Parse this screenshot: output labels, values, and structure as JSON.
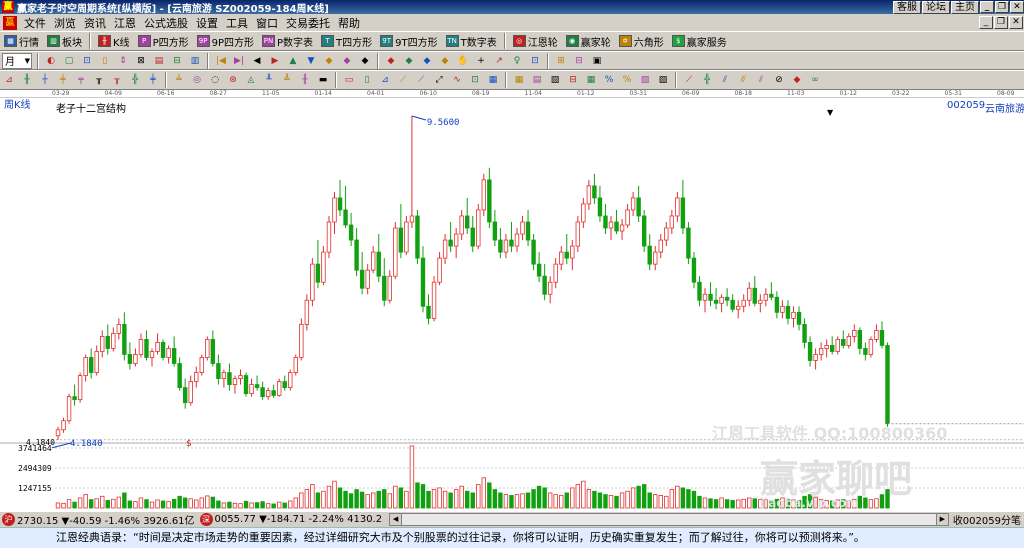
{
  "window": {
    "title": "赢家老子时空周期系统[纵横版] - [云南旅游  SZ002059-184周K线]",
    "links": [
      "客服",
      "论坛",
      "主页"
    ],
    "controls": [
      "_",
      "❐",
      "✕"
    ]
  },
  "menu": [
    "文件",
    "浏览",
    "资讯",
    "江恩",
    "公式选股",
    "设置",
    "工具",
    "窗口",
    "交易委托",
    "帮助"
  ],
  "toolbar1": [
    {
      "icon": "grid-icon",
      "glyph": "▦",
      "color": "#3060a0",
      "label": "行情"
    },
    {
      "icon": "blocks-icon",
      "glyph": "▥",
      "color": "#208040",
      "label": "板块"
    },
    {
      "icon": "kline-icon",
      "glyph": "╫",
      "color": "#c02020",
      "label": "K线"
    },
    {
      "icon": "p-square-icon",
      "glyph": "P",
      "color": "#a040a0",
      "label": "P四方形"
    },
    {
      "icon": "9p-square-icon",
      "glyph": "9P",
      "color": "#a040a0",
      "label": "9P四方形"
    },
    {
      "icon": "pn-square-icon",
      "glyph": "PN",
      "color": "#a040a0",
      "label": "P数字表"
    },
    {
      "icon": "t-square-icon",
      "glyph": "T",
      "color": "#208080",
      "label": "T四方形"
    },
    {
      "icon": "9t-square-icon",
      "glyph": "9T",
      "color": "#208080",
      "label": "9T四方形"
    },
    {
      "icon": "tn-square-icon",
      "glyph": "TN",
      "color": "#208080",
      "label": "T数字表"
    },
    {
      "icon": "gann-wheel-icon",
      "glyph": "◎",
      "color": "#c02020",
      "label": "江恩轮"
    },
    {
      "icon": "winner-wheel-icon",
      "glyph": "◉",
      "color": "#208040",
      "label": "赢家轮"
    },
    {
      "icon": "hexagon-icon",
      "glyph": "✡",
      "color": "#c08000",
      "label": "六角形"
    },
    {
      "icon": "service-icon",
      "glyph": "$",
      "color": "#20a040",
      "label": "赢家服务"
    }
  ],
  "period": {
    "value": "月",
    "arrow": "▼"
  },
  "toolbar2_glyphs": [
    "◐",
    "▢",
    "⊡",
    "▯",
    "⇕",
    "⊠",
    "▤",
    "⊟",
    "▥",
    "|◀",
    "▶|",
    "◀",
    "▶",
    "▲",
    "▼",
    "◆",
    "◆",
    "◆",
    "◆",
    "◆",
    "◆",
    "◆",
    "✋",
    "+",
    "↗",
    "♀",
    "⊡",
    "⊞",
    "⊟",
    "▣"
  ],
  "toolbar3_glyphs": [
    "⊿",
    "╫",
    "┼",
    "╪",
    "╤",
    "╥",
    "┰",
    "╬",
    "╪",
    "╧",
    "◎",
    "◌",
    "⊛",
    "◬",
    "╨",
    "╩",
    "╫",
    "▬",
    "▭",
    "▯",
    "⊿",
    "⟋",
    "⟋",
    "⤢",
    "∿",
    "⊡",
    "▦",
    "▦",
    "▤",
    "▧",
    "⊟",
    "▦",
    "%",
    "%",
    "▧",
    "▨",
    "⟋",
    "╬",
    "⫽",
    "⫻",
    "⫽",
    "⊘",
    "◆",
    "∞"
  ],
  "ruler_dates": [
    "03-29",
    "04-09",
    "06-16",
    "08-27",
    "11-05",
    "01-14",
    "04-01",
    "06-10",
    "08-19",
    "11-04",
    "01-12",
    "03-31",
    "06-09",
    "08-18",
    "11-03",
    "01-12",
    "03-22",
    "05-31",
    "08-09"
  ],
  "chart": {
    "period_label": "周K线",
    "indicator_label": "老子十二宫结构",
    "indicator_arrow": "▼",
    "stock_code": "002059",
    "stock_name": "云南旅游",
    "watermark_line": "江恩工具软件  QQ:100800360",
    "watermark_logo": "赢家聊吧",
    "watermark_url": "jiaoba.vip.com",
    "signal_symbol": "$",
    "up_color": "#e03030",
    "down_color": "#10a010",
    "marker_color": "#1040c0"
  },
  "chart_data": {
    "type": "candlestick",
    "title": "",
    "low_mark": 4.184,
    "high_mark": 9.56,
    "low_mark_label": "4.1840",
    "high_mark_label": "9.5600",
    "volume_ticks": [
      1247155,
      2494309,
      3741464
    ],
    "volume_tick_labels": [
      "1247155",
      "2494309",
      "3741464"
    ],
    "ohlc": [
      [
        4.25,
        4.4,
        4.18,
        4.35
      ],
      [
        4.35,
        4.55,
        4.3,
        4.5
      ],
      [
        4.5,
        4.95,
        4.45,
        4.9
      ],
      [
        4.9,
        5.1,
        4.75,
        4.85
      ],
      [
        4.85,
        5.3,
        4.8,
        5.25
      ],
      [
        5.25,
        5.6,
        5.15,
        5.55
      ],
      [
        5.55,
        5.7,
        5.2,
        5.3
      ],
      [
        5.3,
        5.75,
        5.25,
        5.65
      ],
      [
        5.65,
        6.0,
        5.55,
        5.9
      ],
      [
        5.9,
        6.1,
        5.6,
        5.7
      ],
      [
        5.7,
        6.05,
        5.65,
        5.95
      ],
      [
        5.95,
        6.2,
        5.85,
        6.1
      ],
      [
        6.1,
        6.3,
        5.5,
        5.6
      ],
      [
        5.6,
        5.8,
        5.35,
        5.45
      ],
      [
        5.45,
        5.7,
        5.4,
        5.6
      ],
      [
        5.6,
        5.95,
        5.55,
        5.85
      ],
      [
        5.85,
        6.0,
        5.5,
        5.55
      ],
      [
        5.55,
        5.7,
        5.4,
        5.65
      ],
      [
        5.65,
        5.95,
        5.6,
        5.8
      ],
      [
        5.8,
        5.85,
        5.5,
        5.55
      ],
      [
        5.55,
        5.75,
        5.45,
        5.7
      ],
      [
        5.7,
        5.9,
        5.4,
        5.45
      ],
      [
        5.45,
        5.55,
        5.0,
        5.05
      ],
      [
        5.05,
        5.2,
        4.7,
        4.8
      ],
      [
        4.8,
        5.25,
        4.75,
        5.15
      ],
      [
        5.15,
        5.4,
        5.05,
        5.3
      ],
      [
        5.3,
        5.6,
        5.25,
        5.55
      ],
      [
        5.55,
        5.9,
        5.5,
        5.85
      ],
      [
        5.85,
        6.0,
        5.4,
        5.45
      ],
      [
        5.45,
        5.6,
        5.1,
        5.2
      ],
      [
        5.2,
        5.35,
        5.05,
        5.3
      ],
      [
        5.3,
        5.45,
        5.0,
        5.1
      ],
      [
        5.1,
        5.25,
        4.95,
        5.2
      ],
      [
        5.2,
        5.35,
        5.1,
        5.25
      ],
      [
        5.25,
        5.3,
        4.9,
        4.95
      ],
      [
        4.95,
        5.2,
        4.9,
        5.1
      ],
      [
        5.1,
        5.25,
        5.0,
        5.05
      ],
      [
        5.05,
        5.15,
        4.85,
        4.9
      ],
      [
        4.9,
        5.05,
        4.85,
        5.0
      ],
      [
        5.0,
        5.1,
        4.88,
        4.92
      ],
      [
        4.92,
        5.2,
        4.9,
        5.15
      ],
      [
        5.15,
        5.25,
        5.0,
        5.05
      ],
      [
        5.05,
        5.35,
        5.0,
        5.3
      ],
      [
        5.3,
        5.6,
        5.25,
        5.55
      ],
      [
        5.55,
        6.2,
        5.5,
        6.1
      ],
      [
        6.1,
        6.6,
        6.0,
        6.5
      ],
      [
        6.5,
        7.2,
        6.4,
        7.1
      ],
      [
        7.1,
        7.5,
        6.7,
        6.8
      ],
      [
        6.8,
        7.4,
        6.75,
        7.3
      ],
      [
        7.3,
        7.9,
        7.2,
        7.8
      ],
      [
        7.8,
        8.3,
        7.6,
        8.2
      ],
      [
        8.2,
        8.5,
        7.9,
        8.0
      ],
      [
        8.0,
        8.4,
        7.7,
        7.75
      ],
      [
        7.75,
        7.95,
        7.4,
        7.5
      ],
      [
        7.5,
        7.7,
        6.9,
        7.0
      ],
      [
        7.0,
        7.3,
        6.6,
        6.7
      ],
      [
        6.7,
        7.1,
        6.6,
        7.0
      ],
      [
        7.0,
        7.4,
        6.95,
        7.3
      ],
      [
        7.3,
        7.6,
        6.8,
        6.9
      ],
      [
        6.9,
        7.2,
        6.4,
        6.5
      ],
      [
        6.5,
        7.0,
        6.45,
        6.9
      ],
      [
        6.9,
        7.8,
        6.85,
        7.7
      ],
      [
        7.7,
        8.1,
        7.2,
        7.3
      ],
      [
        7.3,
        7.9,
        7.25,
        7.8
      ],
      [
        7.8,
        9.56,
        7.7,
        7.9
      ],
      [
        7.9,
        8.0,
        7.1,
        7.2
      ],
      [
        7.2,
        7.4,
        6.3,
        6.4
      ],
      [
        6.4,
        6.6,
        6.1,
        6.2
      ],
      [
        6.2,
        6.9,
        6.15,
        6.8
      ],
      [
        6.8,
        7.3,
        6.75,
        7.2
      ],
      [
        7.2,
        7.6,
        7.1,
        7.5
      ],
      [
        7.5,
        7.8,
        7.3,
        7.4
      ],
      [
        7.4,
        7.7,
        7.2,
        7.6
      ],
      [
        7.6,
        8.0,
        7.5,
        7.9
      ],
      [
        7.9,
        8.2,
        7.6,
        7.7
      ],
      [
        7.7,
        7.9,
        7.3,
        7.4
      ],
      [
        7.4,
        8.1,
        7.35,
        8.0
      ],
      [
        8.0,
        8.6,
        7.9,
        8.5
      ],
      [
        8.5,
        8.7,
        7.7,
        7.8
      ],
      [
        7.8,
        8.0,
        7.4,
        7.5
      ],
      [
        7.5,
        7.7,
        7.2,
        7.3
      ],
      [
        7.3,
        7.6,
        7.2,
        7.5
      ],
      [
        7.5,
        7.8,
        7.3,
        7.4
      ],
      [
        7.4,
        7.7,
        7.3,
        7.6
      ],
      [
        7.6,
        7.9,
        7.5,
        7.8
      ],
      [
        7.8,
        8.0,
        7.4,
        7.5
      ],
      [
        7.5,
        7.6,
        7.0,
        7.1
      ],
      [
        7.1,
        7.3,
        6.8,
        6.9
      ],
      [
        6.9,
        7.1,
        6.5,
        6.6
      ],
      [
        6.6,
        6.9,
        6.45,
        6.8
      ],
      [
        6.8,
        7.2,
        6.7,
        7.1
      ],
      [
        7.1,
        7.4,
        7.0,
        7.3
      ],
      [
        7.3,
        7.6,
        7.1,
        7.2
      ],
      [
        7.2,
        7.5,
        7.0,
        7.4
      ],
      [
        7.4,
        7.9,
        7.3,
        7.8
      ],
      [
        7.8,
        8.2,
        7.7,
        8.1
      ],
      [
        8.1,
        8.5,
        8.0,
        8.4
      ],
      [
        8.4,
        8.6,
        8.1,
        8.2
      ],
      [
        8.2,
        8.4,
        7.8,
        7.9
      ],
      [
        7.9,
        8.1,
        7.6,
        7.7
      ],
      [
        7.7,
        7.9,
        7.5,
        7.8
      ],
      [
        7.8,
        8.0,
        7.6,
        7.65
      ],
      [
        7.65,
        7.85,
        7.5,
        7.75
      ],
      [
        7.75,
        8.1,
        7.7,
        8.0
      ],
      [
        8.0,
        8.3,
        7.9,
        8.2
      ],
      [
        8.2,
        8.4,
        7.8,
        7.9
      ],
      [
        7.9,
        8.0,
        7.3,
        7.4
      ],
      [
        7.4,
        7.6,
        7.0,
        7.1
      ],
      [
        7.1,
        7.4,
        7.0,
        7.3
      ],
      [
        7.3,
        7.6,
        7.2,
        7.5
      ],
      [
        7.5,
        7.8,
        7.4,
        7.7
      ],
      [
        7.7,
        8.0,
        7.6,
        7.9
      ],
      [
        7.9,
        8.3,
        7.8,
        8.2
      ],
      [
        8.2,
        8.5,
        7.6,
        7.7
      ],
      [
        7.7,
        7.8,
        7.1,
        7.2
      ],
      [
        7.2,
        7.3,
        6.7,
        6.8
      ],
      [
        6.8,
        6.9,
        6.4,
        6.5
      ],
      [
        6.5,
        6.7,
        6.3,
        6.6
      ],
      [
        6.6,
        6.8,
        6.4,
        6.5
      ],
      [
        6.5,
        6.7,
        6.35,
        6.45
      ],
      [
        6.45,
        6.6,
        6.3,
        6.55
      ],
      [
        6.55,
        6.7,
        6.4,
        6.5
      ],
      [
        6.5,
        6.6,
        6.3,
        6.35
      ],
      [
        6.35,
        6.5,
        6.2,
        6.4
      ],
      [
        6.4,
        6.6,
        6.3,
        6.5
      ],
      [
        6.5,
        6.8,
        6.4,
        6.7
      ],
      [
        6.7,
        6.9,
        6.4,
        6.45
      ],
      [
        6.45,
        6.6,
        6.3,
        6.5
      ],
      [
        6.5,
        6.7,
        6.4,
        6.6
      ],
      [
        6.6,
        6.8,
        6.5,
        6.55
      ],
      [
        6.55,
        6.65,
        6.2,
        6.3
      ],
      [
        6.3,
        6.5,
        6.2,
        6.4
      ],
      [
        6.4,
        6.5,
        6.1,
        6.2
      ],
      [
        6.2,
        6.4,
        6.05,
        6.3
      ],
      [
        6.3,
        6.4,
        6.0,
        6.1
      ],
      [
        6.1,
        6.2,
        5.7,
        5.8
      ],
      [
        5.8,
        5.9,
        5.4,
        5.5
      ],
      [
        5.5,
        5.7,
        5.35,
        5.6
      ],
      [
        5.6,
        5.8,
        5.5,
        5.7
      ],
      [
        5.7,
        5.85,
        5.55,
        5.75
      ],
      [
        5.75,
        5.9,
        5.6,
        5.65
      ],
      [
        5.65,
        5.9,
        5.6,
        5.85
      ],
      [
        5.85,
        6.0,
        5.7,
        5.75
      ],
      [
        5.75,
        5.95,
        5.7,
        5.9
      ],
      [
        5.9,
        6.1,
        5.8,
        6.0
      ],
      [
        6.0,
        6.05,
        5.6,
        5.7
      ],
      [
        5.7,
        5.8,
        5.5,
        5.6
      ],
      [
        5.6,
        5.9,
        5.55,
        5.85
      ],
      [
        5.85,
        6.1,
        5.8,
        6.0
      ],
      [
        6.0,
        6.15,
        5.7,
        5.75
      ],
      [
        5.75,
        5.8,
        4.4,
        4.45
      ]
    ],
    "volume": [
      300,
      280,
      500,
      350,
      600,
      800,
      500,
      550,
      700,
      450,
      520,
      650,
      900,
      420,
      380,
      600,
      500,
      350,
      480,
      420,
      380,
      520,
      700,
      600,
      550,
      480,
      600,
      720,
      650,
      420,
      300,
      350,
      280,
      260,
      400,
      300,
      320,
      380,
      260,
      240,
      350,
      300,
      420,
      600,
      900,
      1100,
      1400,
      900,
      1000,
      1300,
      1600,
      1200,
      1000,
      850,
      1100,
      950,
      800,
      900,
      1000,
      1100,
      850,
      1300,
      1200,
      1000,
      3700,
      1500,
      1400,
      1000,
      1100,
      1200,
      1000,
      900,
      1100,
      1300,
      1000,
      900,
      1400,
      1800,
      1500,
      1100,
      900,
      800,
      750,
      800,
      850,
      900,
      1100,
      1300,
      1200,
      900,
      800,
      750,
      900,
      1200,
      1400,
      1600,
      1100,
      1000,
      900,
      800,
      750,
      700,
      900,
      1000,
      1200,
      1300,
      1400,
      900,
      800,
      750,
      700,
      1100,
      1300,
      1200,
      1100,
      1000,
      700,
      600,
      550,
      500,
      600,
      500,
      450,
      480,
      520,
      600,
      550,
      500,
      480,
      450,
      520,
      600,
      500,
      480,
      450,
      700,
      800,
      650,
      500,
      450,
      420,
      480,
      500,
      450,
      520,
      700,
      600,
      500,
      550,
      800,
      1100
    ]
  },
  "statusbar": {
    "sh_badge": "沪",
    "sh_text": "2730.15 ▼-40.59 -1.46% 3926.61亿",
    "sz_badge": "深",
    "sz_text": "0055.77 ▼-184.71 -2.24% 4130.2",
    "scroll_left": "◀",
    "scroll_right": "▶",
    "right_text": "收002059分笔"
  },
  "quote": {
    "text": "江恩经典语录：“时间是决定市场走势的重要因素，经过详细研究大市及个别股票的过往记录，你将可以证明，历史确实重复发生；而了解过往，你将可以预测将来。”。"
  }
}
